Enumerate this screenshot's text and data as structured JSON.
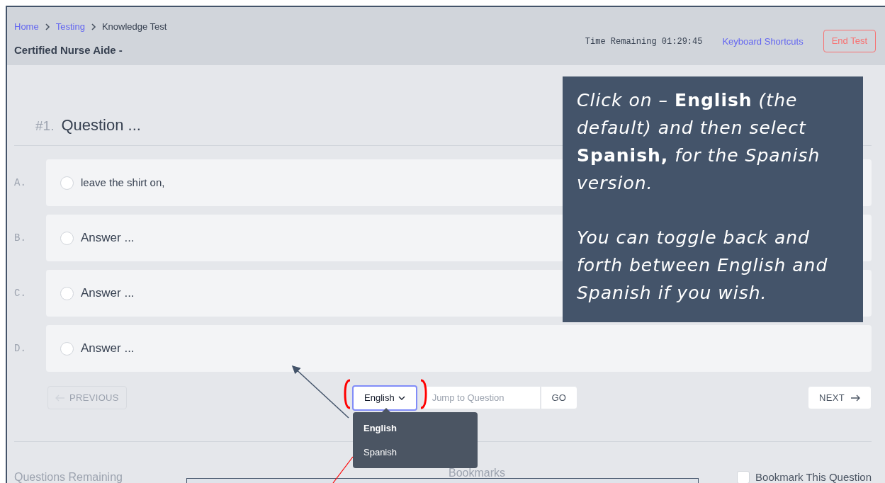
{
  "breadcrumbs": [
    {
      "label": "Home",
      "link": true
    },
    {
      "label": "Testing",
      "link": true
    },
    {
      "label": "Knowledge Test",
      "link": false
    }
  ],
  "exam_title": "Certified Nurse Aide -",
  "timer": {
    "label": "Time Remaining",
    "value": "01:29:45"
  },
  "keyboard_shortcuts": "Keyboard Shortcuts",
  "end_test": "End Test",
  "question": {
    "number": "#1.",
    "text": "Question ..."
  },
  "answers": [
    {
      "letter": "A.",
      "text": "leave the shirt on,",
      "selected": false
    },
    {
      "letter": "B.",
      "text": "Answer ...",
      "selected": false
    },
    {
      "letter": "C.",
      "text": "Answer ...",
      "selected": false
    },
    {
      "letter": "D.",
      "text": "Answer ...",
      "selected": false
    }
  ],
  "previous_button": {
    "label": "PREVIOUS",
    "disabled": true
  },
  "language_select": {
    "value": "English",
    "options": [
      {
        "label": "English",
        "selected": true
      },
      {
        "label": "Spanish",
        "selected": false
      }
    ]
  },
  "jump_field": {
    "placeholder": "Jump to Question"
  },
  "go_button": "GO",
  "next_button": {
    "label": "NEXT",
    "disabled": false
  },
  "footer": {
    "questions_remaining": "Questions Remaining",
    "bookmarks": "Bookmarks",
    "bookmark_checkbox": {
      "label": "Bookmark This Question",
      "checked": false
    }
  },
  "callout": {
    "paragraphs": [
      "Click on – **English** (the default) and then select **Spanish,** for the Spanish version.",
      "You can toggle back and forth between English and Spanish if you wish."
    ]
  }
}
